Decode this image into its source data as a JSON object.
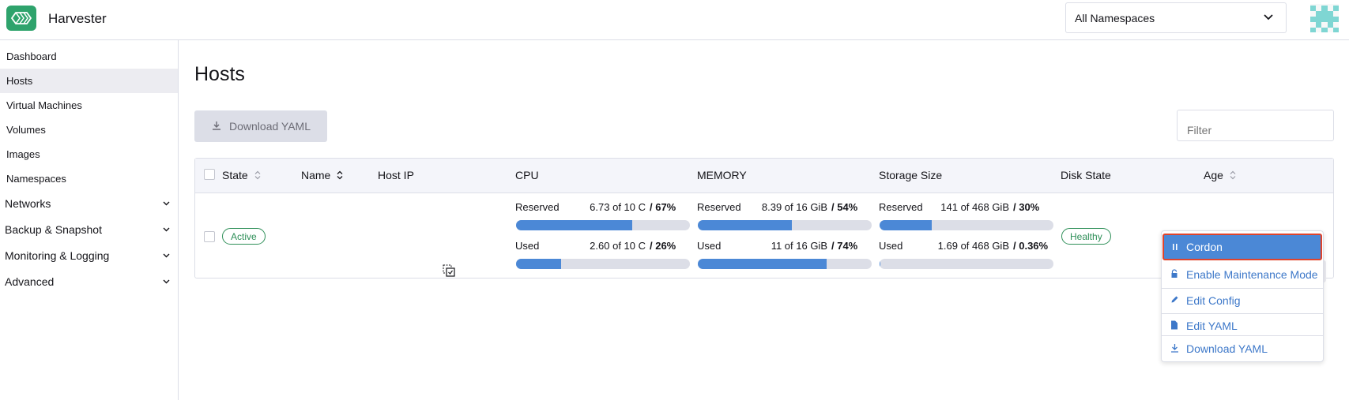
{
  "app": {
    "title": "Harvester"
  },
  "namespace_select": {
    "value": "All Namespaces"
  },
  "sidebar": {
    "items": [
      {
        "label": "Dashboard"
      },
      {
        "label": "Hosts"
      },
      {
        "label": "Virtual Machines"
      },
      {
        "label": "Volumes"
      },
      {
        "label": "Images"
      },
      {
        "label": "Namespaces"
      }
    ],
    "groups": [
      {
        "label": "Networks"
      },
      {
        "label": "Backup & Snapshot"
      },
      {
        "label": "Monitoring & Logging"
      },
      {
        "label": "Advanced"
      }
    ]
  },
  "page": {
    "title": "Hosts",
    "download_label": "Download YAML",
    "filter_placeholder": "Filter"
  },
  "table": {
    "headers": {
      "state": "State",
      "name": "Name",
      "host_ip": "Host IP",
      "cpu": "CPU",
      "memory": "MEMORY",
      "storage": "Storage Size",
      "disk_state": "Disk State",
      "age": "Age"
    },
    "row": {
      "state": "Active",
      "disk_state": "Healthy",
      "cpu": {
        "reserved": {
          "label": "Reserved",
          "value": "6.73 of 10 C",
          "pct": "/ 67%",
          "fraction": 0.67
        },
        "used": {
          "label": "Used",
          "value": "2.60 of 10 C",
          "pct": "/ 26%",
          "fraction": 0.26
        }
      },
      "memory": {
        "reserved": {
          "label": "Reserved",
          "value": "8.39 of 16 GiB",
          "pct": "/ 54%",
          "fraction": 0.54
        },
        "used": {
          "label": "Used",
          "value": "11 of 16 GiB",
          "pct": "/ 74%",
          "fraction": 0.74
        }
      },
      "storage": {
        "reserved": {
          "label": "Reserved",
          "value": "141 of 468 GiB",
          "pct": "/ 30%",
          "fraction": 0.3
        },
        "used": {
          "label": "Used",
          "value": "1.69 of 468 GiB",
          "pct": "/ 0.36%",
          "fraction": 0.0036
        }
      }
    }
  },
  "menu": {
    "items": [
      {
        "label": "Cordon",
        "icon": "pause-icon"
      },
      {
        "label": "Enable Maintenance Mode",
        "icon": "lock-icon"
      },
      {
        "label": "Edit Config",
        "icon": "pencil-icon"
      },
      {
        "label": "Edit YAML",
        "icon": "file-icon"
      },
      {
        "label": "Download YAML",
        "icon": "download-icon"
      }
    ]
  },
  "colors": {
    "brand": "#2ea36c",
    "accent": "#4b88d6",
    "success": "#2e8f58",
    "highlight_border": "#e0442c"
  }
}
